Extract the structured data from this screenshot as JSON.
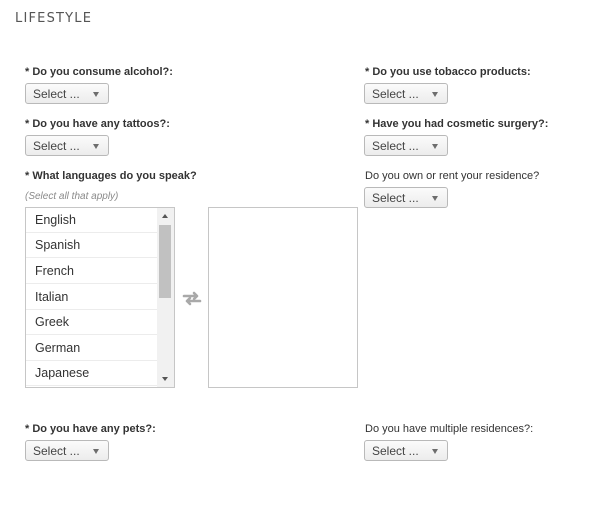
{
  "section": {
    "title": "LIFESTYLE"
  },
  "fields": {
    "alcohol": {
      "label": "* Do you consume alcohol?:",
      "value": "Select ..."
    },
    "tobacco": {
      "label": "* Do you use tobacco products:",
      "value": "Select ..."
    },
    "tattoos": {
      "label": "* Do you have any tattoos?:",
      "value": "Select ..."
    },
    "cosmetic": {
      "label": "* Have you had cosmetic surgery?:",
      "value": "Select ..."
    },
    "languages": {
      "label": "* What languages do you speak?",
      "hint": "(Select all that apply)",
      "options": [
        "English",
        "Spanish",
        "French",
        "Italian",
        "Greek",
        "German",
        "Japanese"
      ]
    },
    "residence": {
      "label": "Do you own or rent your residence?",
      "value": "Select ..."
    },
    "pets": {
      "label": "* Do you have any pets?:",
      "value": "Select ..."
    },
    "multiple_residences": {
      "label": "Do you have multiple residences?:",
      "value": "Select ..."
    }
  },
  "icons": {
    "swap": "swap-arrows-icon",
    "dropdown": "chevron-down-icon"
  }
}
